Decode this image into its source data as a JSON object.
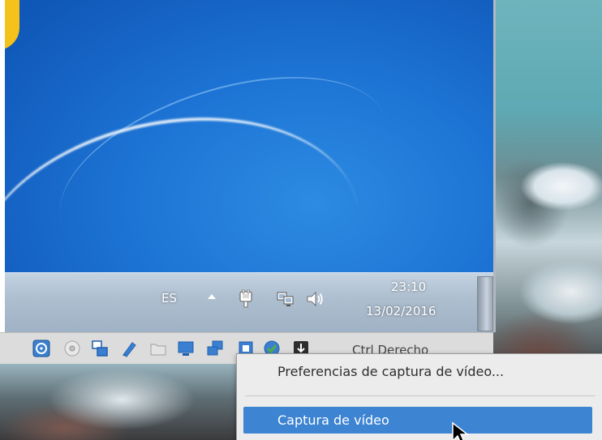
{
  "guest_taskbar": {
    "language": "ES",
    "clock_time": "23:10",
    "clock_date": "13/02/2016",
    "tray_icons": [
      "show-hidden-icons-arrow",
      "power-plug-icon",
      "network-icon",
      "speaker-icon"
    ]
  },
  "vbox_statusbar": {
    "icons": [
      "hard-disk-icon",
      "optical-drive-icon",
      "network-adapters-icon",
      "usb-icon",
      "shared-folders-icon",
      "display-icon",
      "video-capture-icon",
      "cpu-icon",
      "mouse-integration-icon",
      "keyboard-icon"
    ],
    "host_key_label": "Ctrl Derecho"
  },
  "context_menu": {
    "items": [
      {
        "label": "Preferencias de captura de vídeo..."
      },
      {
        "label": "Captura de vídeo"
      }
    ]
  },
  "colors": {
    "wallpaper_blue": "#1d74d4",
    "taskbar": "#aebfd0",
    "statusbar": "#dcdcdc",
    "menu_highlight": "#3d84d2"
  }
}
